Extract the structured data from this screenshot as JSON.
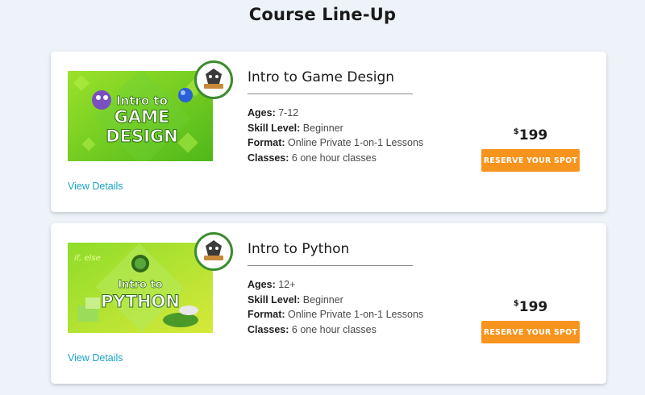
{
  "page": {
    "title": "Course Line-Up"
  },
  "courses": [
    {
      "title": "Intro to Game Design",
      "ages_label": "Ages:",
      "ages": "7-12",
      "skill_label": "Skill Level:",
      "skill": "Beginner",
      "format_label": "Format:",
      "format": "Online Private 1-on-1 Lessons",
      "classes_label": "Classes:",
      "classes": "6 one hour classes",
      "price_currency": "$",
      "price_amount": "199",
      "cta_label": "RESERVE YOUR SPOT",
      "details_label": "View Details",
      "thumb_line1": "Intro to",
      "thumb_line2": "GAME",
      "thumb_line3": "DESIGN"
    },
    {
      "title": "Intro to Python",
      "ages_label": "Ages:",
      "ages": "12+",
      "skill_label": "Skill Level:",
      "skill": "Beginner",
      "format_label": "Format:",
      "format": "Online Private 1-on-1 Lessons",
      "classes_label": "Classes:",
      "classes": "6 one hour classes",
      "price_currency": "$",
      "price_amount": "199",
      "cta_label": "RESERVE YOUR SPOT",
      "details_label": "View Details",
      "thumb_line1": "Intro to",
      "thumb_line2": "PYTHON",
      "thumb_code": "if, else"
    }
  ],
  "colors": {
    "accent": "#f7941d",
    "link": "#1aa3c9",
    "badge_ring": "#3d8b2f",
    "thumb_green": "#7ed321"
  },
  "icons": {
    "badge": "mascot-badge-icon"
  }
}
